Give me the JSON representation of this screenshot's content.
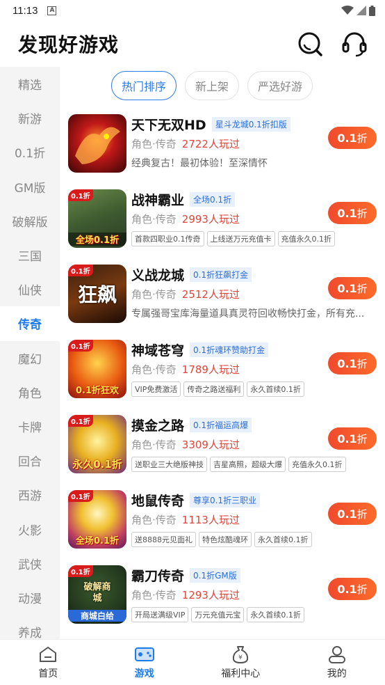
{
  "status": {
    "time": "11:13",
    "notif_icon": "A"
  },
  "header": {
    "title": "发现好游戏"
  },
  "sidebar": {
    "items": [
      {
        "label": "精选"
      },
      {
        "label": "新游"
      },
      {
        "label": "0.1折"
      },
      {
        "label": "GM版"
      },
      {
        "label": "破解版"
      },
      {
        "label": "三国"
      },
      {
        "label": "仙侠"
      },
      {
        "label": "传奇"
      },
      {
        "label": "魔幻"
      },
      {
        "label": "角色"
      },
      {
        "label": "卡牌"
      },
      {
        "label": "回合"
      },
      {
        "label": "西游"
      },
      {
        "label": "火影"
      },
      {
        "label": "武侠"
      },
      {
        "label": "动漫"
      },
      {
        "label": "养成"
      }
    ],
    "active_index": 7
  },
  "tabs": [
    {
      "label": "热门排序"
    },
    {
      "label": "新上架"
    },
    {
      "label": "严选好游"
    }
  ],
  "games": [
    {
      "name": "天下无双HD",
      "badge": "星斗龙城0.1折扣版",
      "genre": "角色·传奇",
      "players": "2722人玩过",
      "desc": "经典复古！最初体验！至深情怀",
      "thumb": {
        "corner": "",
        "center": "",
        "bottom": ""
      },
      "button": {
        "value": "0.1",
        "suffix": "折"
      }
    },
    {
      "name": "战神霸业",
      "badge": "全场0.1折",
      "genre": "角色·传奇",
      "players": "2993人玩过",
      "tags": [
        "首款四职业0.1传奇",
        "上线送万元充值卡",
        "充值永久0.1折"
      ],
      "thumb": {
        "corner": "0.1折",
        "center": "",
        "bottom": "全场0.1折"
      },
      "button": {
        "value": "0.1",
        "suffix": "折"
      }
    },
    {
      "name": "义战龙城",
      "badge": "0.1折狂飙打金",
      "genre": "角色·传奇",
      "players": "2512人玩过",
      "desc": "专属强哥宝库海量道具真灵符回收畅快打金，所有充...",
      "thumb": {
        "corner": "0.1折",
        "center": "狂飙",
        "bottom": ""
      },
      "button": {
        "value": "0.1",
        "suffix": "折"
      }
    },
    {
      "name": "神域苍穹",
      "badge": "0.1折魂环赞助打金",
      "genre": "角色·传奇",
      "players": "1789人玩过",
      "tags": [
        "VIP免费激活",
        "传奇之路送福利",
        "永久首续0.1折"
      ],
      "thumb": {
        "corner": "0.1折",
        "center": "",
        "bottom": "0.1折狂欢"
      },
      "button": {
        "value": "0.1",
        "suffix": "折"
      }
    },
    {
      "name": "摸金之路",
      "badge": "0.1折福运高爆",
      "genre": "角色·传奇",
      "players": "3309人玩过",
      "tags": [
        "送职业三大绝版神技",
        "吉星高照，超级大爆",
        "充值永久0.1折"
      ],
      "thumb": {
        "corner": "0.1折",
        "center": "",
        "bottom": "永久0.1折"
      },
      "button": {
        "value": "0.1",
        "suffix": "折"
      }
    },
    {
      "name": "地鼠传奇",
      "badge": "尊享0.1折三职业",
      "genre": "角色·传奇",
      "players": "1113人玩过",
      "tags": [
        "送8888元见面礼",
        "特色炫酷魂环",
        "永久首续0.1折"
      ],
      "thumb": {
        "corner": "0.1折",
        "center": "",
        "bottom": "全场0.1折"
      },
      "button": {
        "value": "0.1",
        "suffix": "折"
      }
    },
    {
      "name": "霸刀传奇",
      "badge": "0.1折GM版",
      "genre": "角色·传奇",
      "players": "1293人玩过",
      "tags": [
        "开局送满级VIP",
        "万元充值元宝",
        "永久首续0.1折"
      ],
      "thumb": {
        "corner": "0.1折",
        "center": "破解商城",
        "bottom": "商城白给"
      },
      "button": {
        "value": "0.1",
        "suffix": "折"
      }
    }
  ],
  "bottom_nav": [
    {
      "label": "首页",
      "icon": "home-icon"
    },
    {
      "label": "游戏",
      "icon": "gamepad-icon"
    },
    {
      "label": "福利中心",
      "icon": "money-bag-icon"
    },
    {
      "label": "我的",
      "icon": "user-icon"
    }
  ],
  "colors": {
    "accent": "#1e7be8",
    "button": "#f04a2c",
    "players": "#e0443a"
  }
}
